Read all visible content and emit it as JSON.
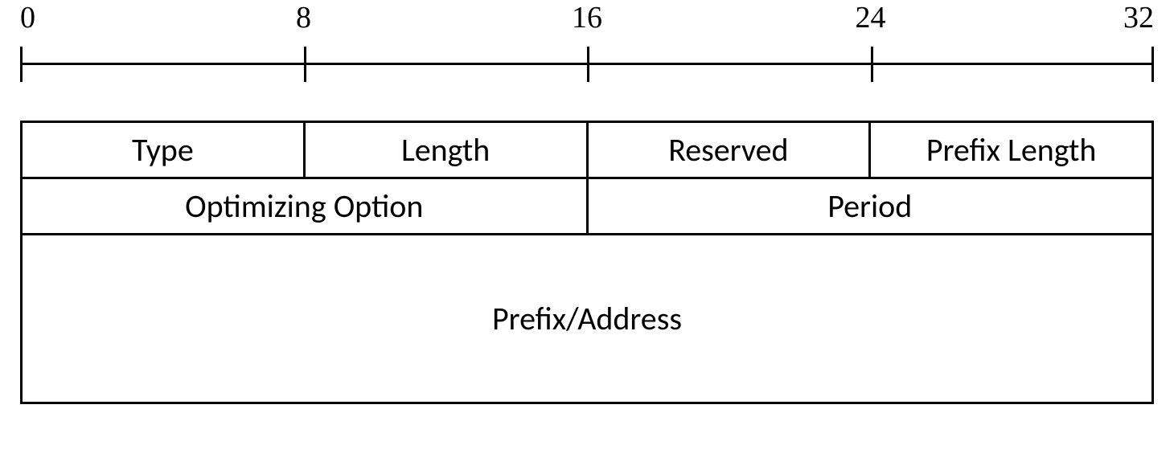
{
  "ruler": {
    "ticks": [
      "0",
      "8",
      "16",
      "24",
      "32"
    ]
  },
  "fields": {
    "type": "Type",
    "length": "Length",
    "reserved": "Reserved",
    "prefix_length": "Prefix Length",
    "optimizing_option": "Optimizing Option",
    "period": "Period",
    "prefix_address": "Prefix/Address"
  }
}
